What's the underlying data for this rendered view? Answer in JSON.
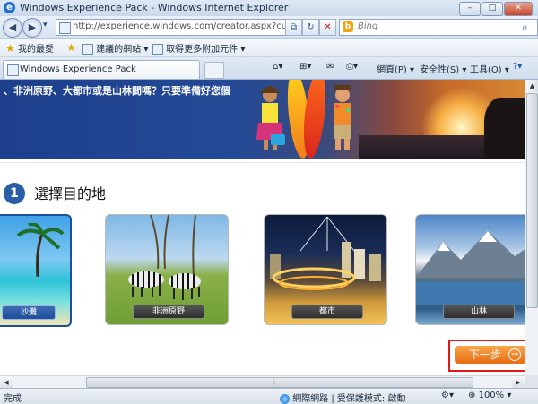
{
  "window": {
    "title": "Windows Experience Pack - Windows Internet Explorer",
    "min": "–",
    "max": "□",
    "close": "✕"
  },
  "address": {
    "url": "http://experience.windows.com/creator.aspx?culture",
    "back": "◀",
    "forward": "▶",
    "dropdown": "▾",
    "compat": "⧉",
    "refresh": "↻",
    "stop": "✕"
  },
  "search": {
    "placeholder": "Bing",
    "engine": "b",
    "icon": "⌕"
  },
  "favorites_bar": {
    "favorites": "我的最愛",
    "suggested": "建議的網站 ▾",
    "addons": "取得更多附加元件 ▾"
  },
  "tab": {
    "title": "Windows Experience Pack"
  },
  "commands": {
    "home": "⌂▾",
    "feeds": "⊞▾",
    "mail": "✉",
    "print": "⎙▾",
    "page": "網頁(P) ▾",
    "safety": "安全性(S) ▾",
    "tools": "工具(O) ▾",
    "help": "?▾"
  },
  "banner": {
    "slogan": "、非洲原野、大都市或是山林間嗎？只要準備好您個"
  },
  "step": {
    "number": "1",
    "title": "選擇目的地"
  },
  "destinations": [
    {
      "label": "沙灘",
      "selected": true
    },
    {
      "label": "非洲原野",
      "selected": false
    },
    {
      "label": "都市",
      "selected": false
    },
    {
      "label": "山林",
      "selected": false
    }
  ],
  "next_button": {
    "label": "下一步",
    "arrow": "→"
  },
  "scroll": {
    "up": "▲",
    "left": "◀",
    "right": "▶",
    "grip": "⦙"
  },
  "statusbar": {
    "status": "完成",
    "zone": "網際網路 | 受保護模式: 啟動",
    "security": "⚙▾",
    "zoom": "100%",
    "zoom_dropdown": "▾"
  }
}
